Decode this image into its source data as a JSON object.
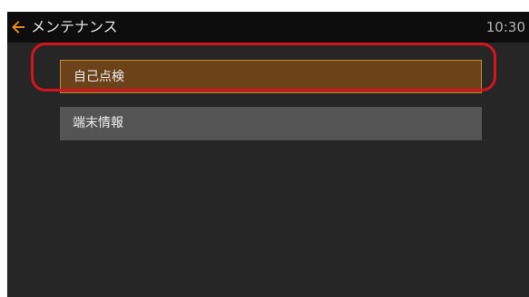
{
  "header": {
    "title": "メンテナンス",
    "time": "10:30",
    "back_icon": "back-arrow-icon",
    "accent_color": "#e8891d"
  },
  "menu": {
    "items": [
      {
        "label": "自己点検",
        "selected": true
      },
      {
        "label": "端末情報",
        "selected": false
      }
    ]
  },
  "annotation": {
    "highlight_color": "#d9131d"
  }
}
